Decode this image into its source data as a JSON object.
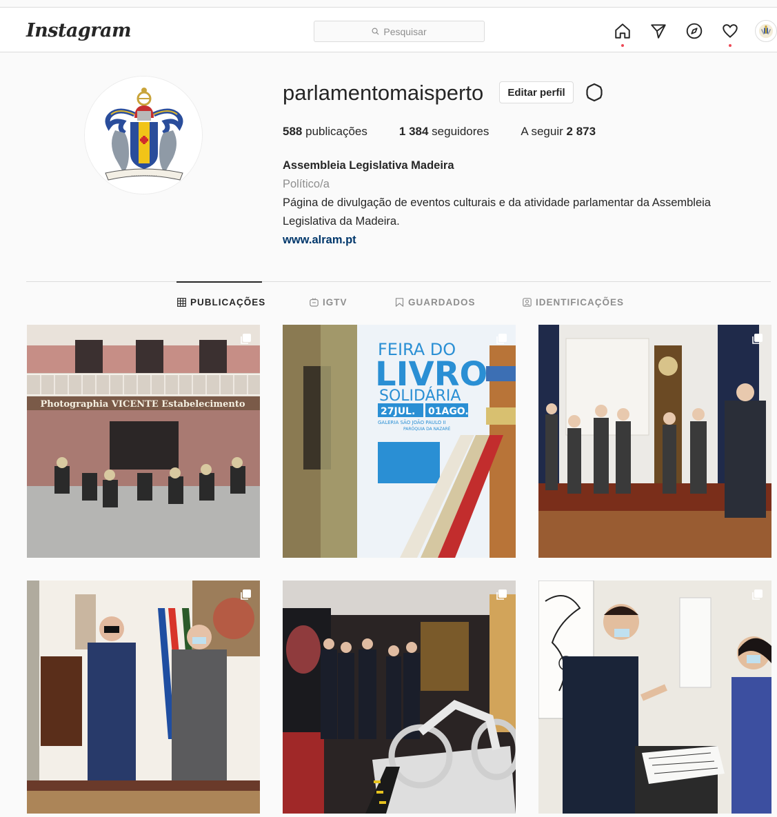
{
  "header": {
    "logo": "Instagram",
    "search_placeholder": "Pesquisar",
    "nav_icons": [
      "home-icon",
      "direct-icon",
      "explore-icon",
      "activity-heart-icon",
      "profile-avatar-icon"
    ]
  },
  "profile": {
    "username": "parlamentomaisperto",
    "edit_label": "Editar perfil",
    "stats": {
      "posts_count": "588",
      "posts_label": "publicações",
      "followers_count": "1 384",
      "followers_label": "seguidores",
      "following_label": "A seguir",
      "following_count": "2 873"
    },
    "bio": {
      "name": "Assembleia Legislativa Madeira",
      "category": "Político/a",
      "description": "Página de divulgação de eventos culturais e da atividade parlamentar da Assembleia Legislativa da Madeira.",
      "website": "www.alram.pt"
    }
  },
  "tabs": [
    {
      "label": "PUBLICAÇÕES",
      "icon": "grid-icon",
      "active": true
    },
    {
      "label": "IGTV",
      "icon": "igtv-icon",
      "active": false
    },
    {
      "label": "GUARDADOS",
      "icon": "bookmark-icon",
      "active": false
    },
    {
      "label": "IDENTIFICAÇÕES",
      "icon": "tagged-icon",
      "active": false
    }
  ],
  "posts": [
    {
      "name": "post-photographia-vicente",
      "sign_text": "Photographia VICENTE Estabelecimento",
      "multi": true
    },
    {
      "name": "post-feira-do-livro",
      "poster": {
        "line1": "FEIRA DO",
        "line2": "LIVRO",
        "line3": "SOLIDÁRIA",
        "date1": "27JUL.",
        "date2": "01AGO.",
        "venue1": "GALERIA SÃO JOÃO PAULO II",
        "venue2": "PARÓQUIA DA NAZARÉ"
      },
      "multi": true
    },
    {
      "name": "post-visita-sala",
      "multi": true
    },
    {
      "name": "post-militar-reuniao",
      "multi": true
    },
    {
      "name": "post-exposicao-mota",
      "multi": true
    },
    {
      "name": "post-exposicao-galeria",
      "multi": true
    }
  ],
  "colors": {
    "text": "#262626",
    "muted": "#8e8e8e",
    "link": "#00376b",
    "border": "#dbdbdb",
    "notification": "#ed4956"
  }
}
